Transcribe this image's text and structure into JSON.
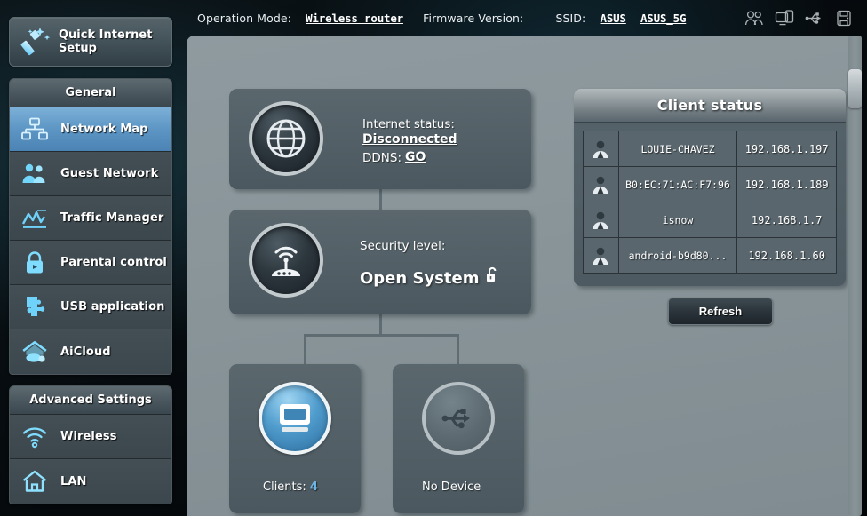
{
  "topbar": {
    "operation_mode_label": "Operation Mode:",
    "operation_mode_value": "Wireless router",
    "firmware_label": "Firmware Version:",
    "firmware_value": "",
    "ssid_label": "SSID:",
    "ssid_1": "ASUS",
    "ssid_2": "ASUS_5G",
    "icons": [
      "clients-icon",
      "devices-icon",
      "usb-icon",
      "printer-icon"
    ]
  },
  "sidebar": {
    "quick_setup_label": "Quick Internet\nSetup",
    "general": {
      "header": "General",
      "items": [
        {
          "label": "Network Map",
          "icon": "network-map-icon",
          "active": true
        },
        {
          "label": "Guest Network",
          "icon": "guest-network-icon",
          "active": false
        },
        {
          "label": "Traffic Manager",
          "icon": "traffic-manager-icon",
          "active": false
        },
        {
          "label": "Parental control",
          "icon": "parental-control-icon",
          "active": false
        },
        {
          "label": "USB application",
          "icon": "usb-application-icon",
          "active": false
        },
        {
          "label": "AiCloud",
          "icon": "aicloud-icon",
          "active": false
        }
      ]
    },
    "advanced": {
      "header": "Advanced Settings",
      "items": [
        {
          "label": "Wireless",
          "icon": "wireless-icon",
          "active": false
        },
        {
          "label": "LAN",
          "icon": "lan-icon",
          "active": false
        }
      ]
    }
  },
  "main": {
    "internet": {
      "status_label": "Internet status:",
      "status_value": "Disconnected",
      "ddns_label": "DDNS:",
      "ddns_value": "GO",
      "icon": "globe-icon"
    },
    "security": {
      "label": "Security level:",
      "value": "Open System",
      "icon": "router-icon",
      "lock_icon": "open-padlock-icon"
    },
    "clients_node": {
      "label_prefix": "Clients: ",
      "count": "4",
      "icon": "monitor-icon"
    },
    "usb_node": {
      "label": "No Device",
      "icon": "usb-icon"
    }
  },
  "client_status": {
    "title": "Client status",
    "rows": [
      {
        "icon": "user-icon",
        "name": "LOUIE-CHAVEZ",
        "ip": "192.168.1.197"
      },
      {
        "icon": "user-icon",
        "name": "B0:EC:71:AC:F7:96",
        "ip": "192.168.1.189"
      },
      {
        "icon": "user-icon",
        "name": "isnow",
        "ip": "192.168.1.7"
      },
      {
        "icon": "user-icon",
        "name": "android-b9d80...",
        "ip": "192.168.1.60"
      }
    ],
    "refresh_label": "Refresh"
  },
  "colors": {
    "accent_blue": "#5b93c2",
    "panel_bg": "#8e9a9f",
    "card_bg": "#525f66",
    "count_blue": "#6fb6e6"
  }
}
